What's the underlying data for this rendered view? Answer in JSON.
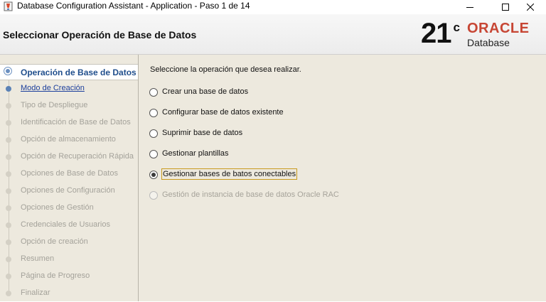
{
  "window": {
    "title": "Database Configuration Assistant - Application - Paso 1 de 14",
    "icons": [
      "app-icon",
      "minimize-icon",
      "maximize-icon",
      "close-icon"
    ]
  },
  "banner": {
    "heading": "Seleccionar Operación de Base de Datos",
    "logo_number": "21",
    "logo_superscript": "c",
    "logo_brand": "ORACLE",
    "logo_product": "Database",
    "brand_color": "#c74634"
  },
  "steps": [
    {
      "label": "Operación de Base de Datos",
      "state": "current"
    },
    {
      "label": "Modo de Creación",
      "state": "link"
    },
    {
      "label": "Tipo de Despliegue",
      "state": "disabled"
    },
    {
      "label": "Identificación de Base de Datos",
      "state": "disabled"
    },
    {
      "label": "Opción de almacenamiento",
      "state": "disabled"
    },
    {
      "label": "Opción de Recuperación Rápida",
      "state": "disabled"
    },
    {
      "label": "Opciones de Base de Datos",
      "state": "disabled"
    },
    {
      "label": "Opciones de Configuración",
      "state": "disabled"
    },
    {
      "label": "Opciones de Gestión",
      "state": "disabled"
    },
    {
      "label": "Credenciales de Usuarios",
      "state": "disabled"
    },
    {
      "label": "Opción de creación",
      "state": "disabled"
    },
    {
      "label": "Resumen",
      "state": "disabled"
    },
    {
      "label": "Página de Progreso",
      "state": "disabled"
    },
    {
      "label": "Finalizar",
      "state": "disabled"
    }
  ],
  "content": {
    "prompt": "Seleccione la operación que desea realizar.",
    "options": [
      {
        "label": "Crear una base de datos",
        "selected": false,
        "enabled": true
      },
      {
        "label": "Configurar base de datos existente",
        "selected": false,
        "enabled": true
      },
      {
        "label": "Suprimir base de datos",
        "selected": false,
        "enabled": true
      },
      {
        "label": "Gestionar plantillas",
        "selected": false,
        "enabled": true
      },
      {
        "label": "Gestionar bases de batos conectables",
        "selected": true,
        "enabled": true
      },
      {
        "label": "Gestión de instancia de base de datos Oracle RAC",
        "selected": false,
        "enabled": false
      }
    ]
  }
}
